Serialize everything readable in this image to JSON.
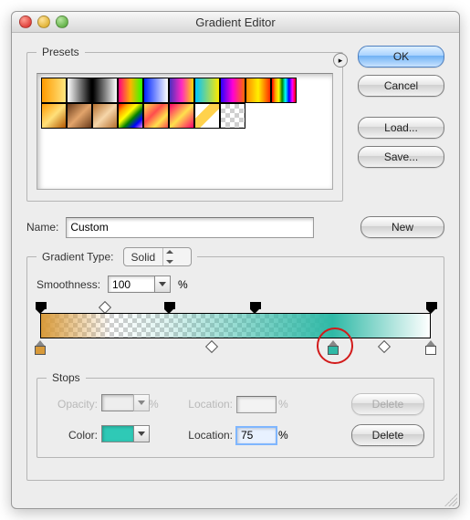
{
  "window": {
    "title": "Gradient Editor"
  },
  "buttons": {
    "ok": "OK",
    "cancel": "Cancel",
    "load": "Load...",
    "save": "Save...",
    "new": "New",
    "delete": "Delete"
  },
  "presets": {
    "legend": "Presets",
    "swatches": [
      "linear-gradient(90deg,#ff9a00,#ffe680)",
      "linear-gradient(90deg,#fff,#000)",
      "linear-gradient(90deg,#000,#fff)",
      "linear-gradient(90deg,#ff0080,#ffb300,#2bff00)",
      "linear-gradient(90deg,#0026ff,#fff)",
      "linear-gradient(90deg,#4a2fbd,#ff29c3,#ffd800)",
      "linear-gradient(90deg,#00c3ff,#ffea00)",
      "linear-gradient(90deg,#2a00ff,#ff00d4,#ff6a00)",
      "linear-gradient(90deg,#ff8a00,#ffef00,#ff2a00)",
      "linear-gradient(90deg,red,orange,yellow,green,cyan,blue,magenta,red)",
      "linear-gradient(135deg,#ff9a00,#ffe07a 50%,#b25600)",
      "linear-gradient(135deg,#6a3b1b,#e2a46b 50%,#6a3b1b)",
      "linear-gradient(135deg,#b56f2e,#f6d6a9 50%,#b56f2e)",
      "linear-gradient(135deg,red,orange,yellow,green,blue,violet)",
      "linear-gradient(135deg,#ffe14d,#ff4d4d 40%,#ffe14d 70%,#ff4d4d)",
      "linear-gradient(135deg,#ff006a,#ffe14d 50%,#ff006a)",
      "linear-gradient(135deg,#fff 0,#fff 30%,#ffd24d 30%,#ffd24d 60%,#fff 60%)",
      "checker"
    ]
  },
  "name": {
    "label": "Name:",
    "value": "Custom"
  },
  "gradient_type": {
    "legend": "Gradient Type:",
    "value": "Solid"
  },
  "smoothness": {
    "label": "Smoothness:",
    "value": "100",
    "unit": "%"
  },
  "gradient": {
    "opacity_stops": [
      0,
      33,
      55,
      100
    ],
    "opacity_mids": [
      16.5
    ],
    "color_stops": [
      {
        "pos": 0,
        "color": "#d89a3a"
      },
      {
        "pos": 75,
        "color": "#2fb9a6"
      },
      {
        "pos": 100,
        "color": "#ffffff"
      }
    ],
    "color_mids": [
      44,
      88
    ],
    "highlight_stop_index": 1,
    "css": "linear-gradient(90deg, rgba(216,154,58,1) 0%, rgba(216,154,58,0) 18%, rgba(47,185,166,0.15) 32%, rgba(47,185,166,1) 75%, #ffffff 100%)"
  },
  "stops": {
    "legend": "Stops",
    "opacity": {
      "label": "Opacity:",
      "value": "",
      "unit": "%",
      "enabled": false
    },
    "opacity_location": {
      "label": "Location:",
      "value": "",
      "unit": "%",
      "enabled": false
    },
    "color": {
      "label": "Color:",
      "value": "#2fc9b6",
      "enabled": true
    },
    "color_location": {
      "label": "Location:",
      "value": "75",
      "unit": "%",
      "enabled": true
    }
  }
}
